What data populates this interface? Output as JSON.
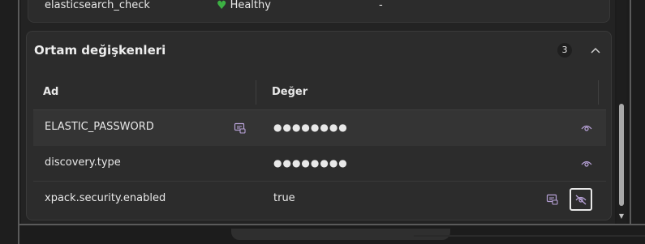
{
  "previous_row": {
    "name": "elasticsearch_check",
    "status": "Healthy",
    "value": "-"
  },
  "env_section": {
    "title": "Ortam değişkenleri",
    "count": "3",
    "columns": {
      "name": "Ad",
      "value": "Değer"
    },
    "rows": [
      {
        "name": "ELASTIC_PASSWORD",
        "value": "●●●●●●●●",
        "has_copy": true,
        "visibility": "eye"
      },
      {
        "name": "discovery.type",
        "value": "●●●●●●●●",
        "has_copy": false,
        "visibility": "eye"
      },
      {
        "name": "xpack.security.enabled",
        "value": "true",
        "has_copy": true,
        "visibility": "eye-off"
      }
    ]
  },
  "colors": {
    "healthy": "#3cb043",
    "icon_accent": "#b8a2d8"
  }
}
